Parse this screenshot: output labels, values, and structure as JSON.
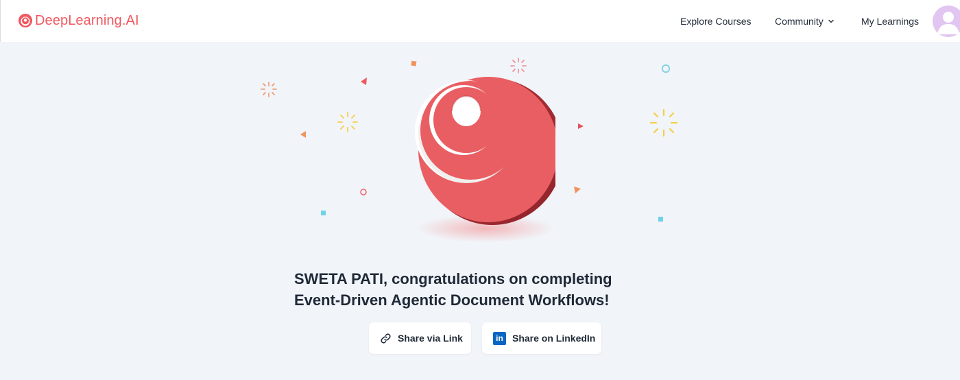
{
  "header": {
    "brand": "DeepLearning.AI",
    "nav": {
      "explore": "Explore Courses",
      "community": "Community",
      "learnings": "My Learnings"
    }
  },
  "main": {
    "headline_line1": "SWETA PATI, congratulations on completing",
    "headline_line2": "Event-Driven Agentic Document Workflows!"
  },
  "actions": {
    "share_link": "Share via Link",
    "share_linkedin": "Share on LinkedIn",
    "linkedin_glyph": "in"
  },
  "icons": {
    "brand": "deeplearning-logo-icon",
    "dropdown": "chevron-down-icon",
    "avatar": "user-avatar-icon",
    "link": "link-icon",
    "linkedin": "linkedin-icon",
    "hero": "deeplearning-3d-logo-icon"
  },
  "colors": {
    "brand": "#f0575e",
    "background": "#f1f4f8",
    "linkedin": "#0a66c2",
    "avatar": "#e2c6f1"
  }
}
